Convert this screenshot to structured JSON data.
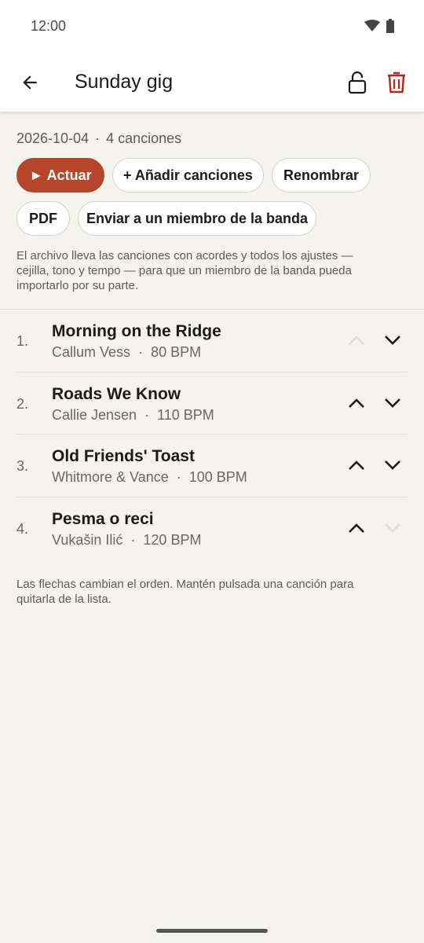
{
  "status": {
    "time": "12:00"
  },
  "header": {
    "title": "Sunday gig"
  },
  "meta": {
    "date": "2026-10-04",
    "separator": "·",
    "count": "4 canciones"
  },
  "actions": {
    "play": "► Actuar",
    "add": "+ Añadir canciones",
    "rename": "Renombrar",
    "pdf": "PDF",
    "send": "Enviar a un miembro de la banda"
  },
  "note": "El archivo lleva las canciones con acordes y todos los ajustes — cejilla, tono y tempo — para que un miembro de la banda pueda importarlo por su parte.",
  "songs": [
    {
      "num": "1.",
      "title": "Morning on the Ridge",
      "artist": "Callum Vess",
      "sep": "·",
      "bpm": "80 BPM",
      "up_enabled": false,
      "down_enabled": true
    },
    {
      "num": "2.",
      "title": "Roads We Know",
      "artist": "Callie Jensen",
      "sep": "·",
      "bpm": "110 BPM",
      "up_enabled": true,
      "down_enabled": true
    },
    {
      "num": "3.",
      "title": "Old Friends' Toast",
      "artist": "Whitmore & Vance",
      "sep": "·",
      "bpm": "100 BPM",
      "up_enabled": true,
      "down_enabled": true
    },
    {
      "num": "4.",
      "title": "Pesma o reci",
      "artist": "Vukašin Ilić",
      "sep": "·",
      "bpm": "120 BPM",
      "up_enabled": true,
      "down_enabled": false
    }
  ],
  "hint": "Las flechas cambian el orden. Mantén pulsada una canción para quitarla de la lista.",
  "colors": {
    "accent": "#b5462a",
    "trash": "#b3261e",
    "disabled_arrow": "#dcd8d1"
  },
  "icons": {
    "back": "arrow-left-icon",
    "lock": "lock-open-icon",
    "trash": "trash-icon",
    "up": "chevron-up-icon",
    "down": "chevron-down-icon",
    "wifi": "wifi-icon",
    "battery": "battery-icon"
  }
}
